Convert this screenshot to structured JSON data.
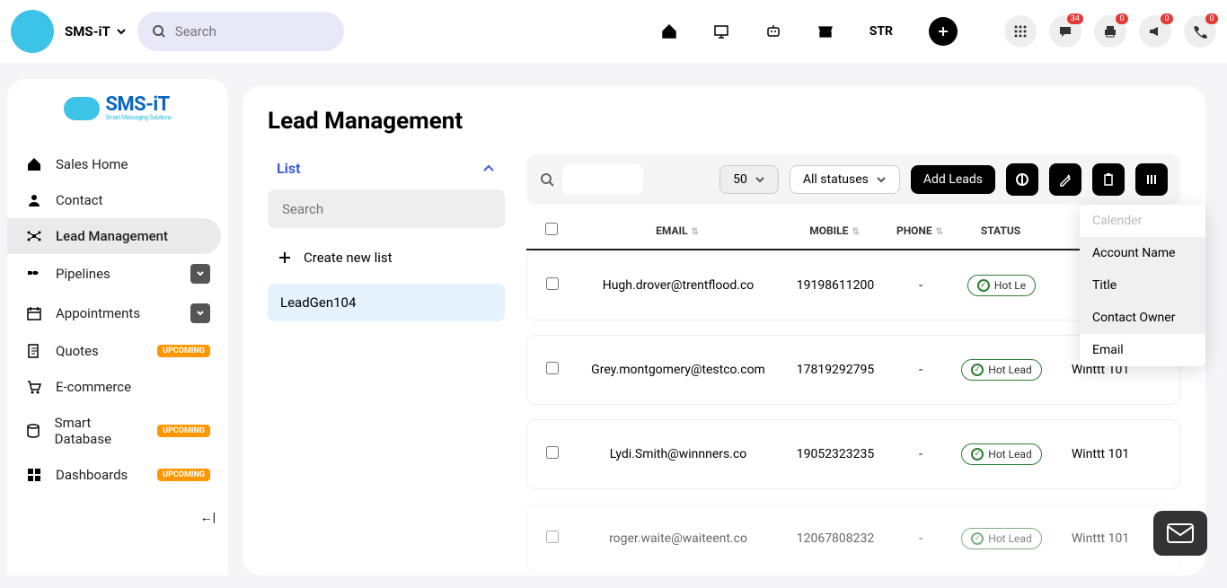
{
  "app": {
    "name": "SMS-iT"
  },
  "search": {
    "placeholder": "Search"
  },
  "topnav": {
    "str": "STR"
  },
  "badges": {
    "chat": "34",
    "print": "0",
    "announce": "0",
    "phone": "0"
  },
  "logo": {
    "main": "SMS-iT",
    "sub": "Smart Messaging Solutions"
  },
  "sidebar": {
    "items": [
      {
        "label": "Sales Home"
      },
      {
        "label": "Contact"
      },
      {
        "label": "Lead Management"
      },
      {
        "label": "Pipelines"
      },
      {
        "label": "Appointments"
      },
      {
        "label": "Quotes",
        "badge": "UPCOMING"
      },
      {
        "label": "E-commerce"
      },
      {
        "label": "Smart Database",
        "badge": "UPCOMING"
      },
      {
        "label": "Dashboards",
        "badge": "UPCOMING"
      }
    ]
  },
  "page": {
    "title": "Lead Management"
  },
  "list": {
    "header": "List",
    "search_placeholder": "Search",
    "create": "Create new list",
    "items": [
      {
        "name": "LeadGen104"
      }
    ]
  },
  "toolbar": {
    "page_size": "50",
    "status_filter": "All statuses",
    "add_leads": "Add Leads"
  },
  "table": {
    "headers": {
      "email": "EMAIL",
      "mobile": "MOBILE",
      "phone": "PHONE",
      "status": "STATUS"
    },
    "rows": [
      {
        "email": "Hugh.drover@trentflood.co",
        "mobile": "19198611200",
        "phone": "-",
        "status": "Hot Le",
        "account": ""
      },
      {
        "email": "Grey.montgomery@testco.com",
        "mobile": "17819292795",
        "phone": "-",
        "status": "Hot Lead",
        "account": "Winttt 101"
      },
      {
        "email": "Lydi.Smith@winnners.co",
        "mobile": "19052323235",
        "phone": "-",
        "status": "Hot Lead",
        "account": "Winttt 101"
      },
      {
        "email": "roger.waite@waiteent.co",
        "mobile": "12067808232",
        "phone": "-",
        "status": "Hot Lead",
        "account": "Winttt 101"
      }
    ]
  },
  "dropdown": {
    "items": [
      {
        "label": "Calender",
        "disabled": true
      },
      {
        "label": "Account Name"
      },
      {
        "label": "Title"
      },
      {
        "label": "Contact Owner"
      },
      {
        "label": "Email"
      }
    ]
  }
}
